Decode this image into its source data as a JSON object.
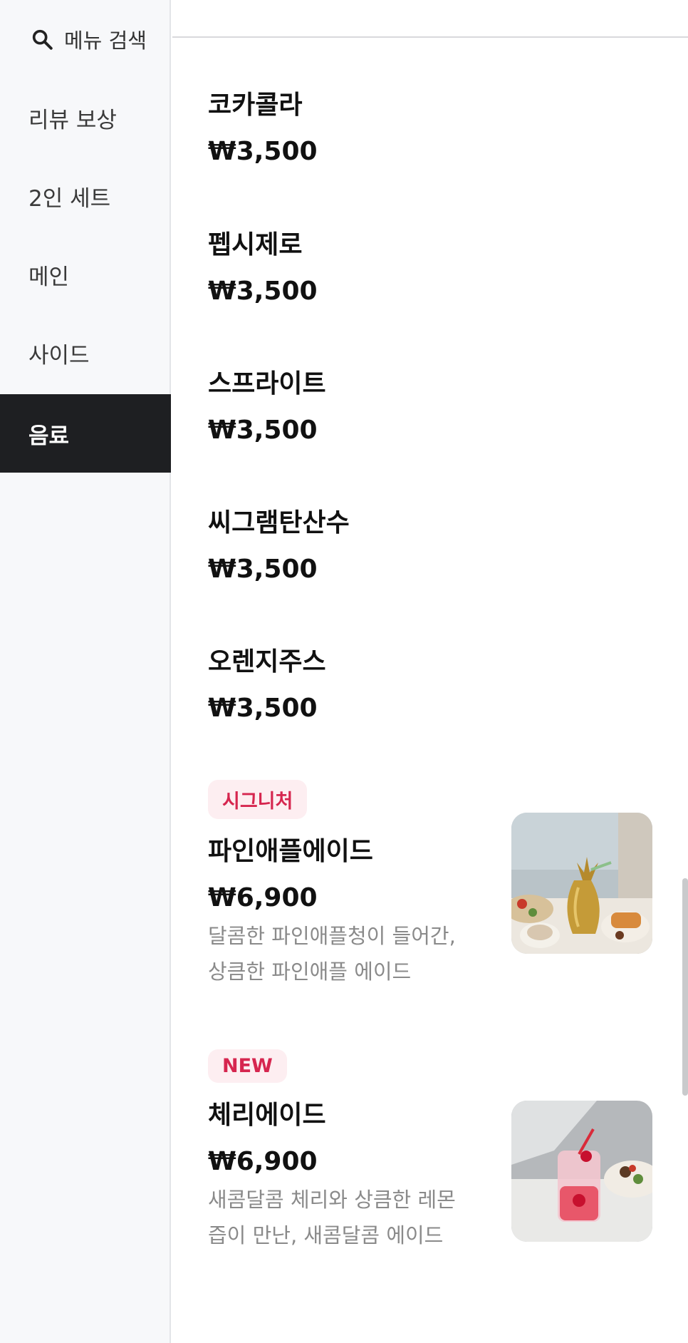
{
  "search": {
    "label": "메뉴 검색",
    "icon": "search-icon"
  },
  "sidebar": {
    "categories": [
      {
        "label": "리뷰 보상"
      },
      {
        "label": "2인 세트"
      },
      {
        "label": "메인"
      },
      {
        "label": "사이드"
      },
      {
        "label": "음료",
        "active": true
      }
    ]
  },
  "menu": {
    "items": [
      {
        "name": "코카콜라",
        "price": "₩3,500"
      },
      {
        "name": "펩시제로",
        "price": "₩3,500"
      },
      {
        "name": "스프라이트",
        "price": "₩3,500"
      },
      {
        "name": "씨그램탄산수",
        "price": "₩3,500"
      },
      {
        "name": "오렌지주스",
        "price": "₩3,500"
      },
      {
        "badge": "시그니처",
        "name": "파인애플에이드",
        "price": "₩6,900",
        "description": "달콤한 파인애플청이 들어간, 상큼한 파인애플 에이드"
      },
      {
        "badge": "NEW",
        "name": "체리에이드",
        "price": "₩6,900",
        "description": "새콤달콤 체리와 상큼한 레몬즙이 만난, 새콤달콤 에이드"
      }
    ]
  },
  "colors": {
    "sidebar_bg": "#f7f8fa",
    "active_bg": "#1e1f22",
    "badge_bg": "#fdeef1",
    "badge_text": "#d6264f",
    "desc_text": "#8a8a8a"
  }
}
